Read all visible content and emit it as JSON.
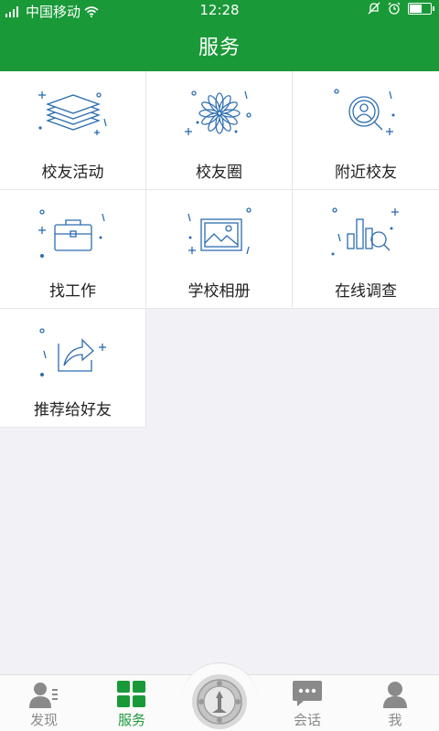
{
  "status": {
    "carrier": "中国移动",
    "time": "12:28",
    "battery_level": 0.6
  },
  "header": {
    "title": "服务"
  },
  "services": [
    {
      "label": "校友活动",
      "icon": "layers-icon"
    },
    {
      "label": "校友圈",
      "icon": "flower-icon"
    },
    {
      "label": "附近校友",
      "icon": "user-search-icon"
    },
    {
      "label": "找工作",
      "icon": "briefcase-icon"
    },
    {
      "label": "学校相册",
      "icon": "picture-icon"
    },
    {
      "label": "在线调查",
      "icon": "chart-search-icon"
    },
    {
      "label": "推荐给好友",
      "icon": "share-icon"
    }
  ],
  "tabs": [
    {
      "label": "发现",
      "icon": "contacts-icon"
    },
    {
      "label": "服务",
      "icon": "grid-icon",
      "active": true
    },
    {
      "label": "会话",
      "icon": "chat-icon"
    },
    {
      "label": "我",
      "icon": "person-icon"
    }
  ],
  "colors": {
    "brand": "#1a9938",
    "icon_line": "#2b6cb0",
    "tab_inactive": "#8a8a8a"
  }
}
